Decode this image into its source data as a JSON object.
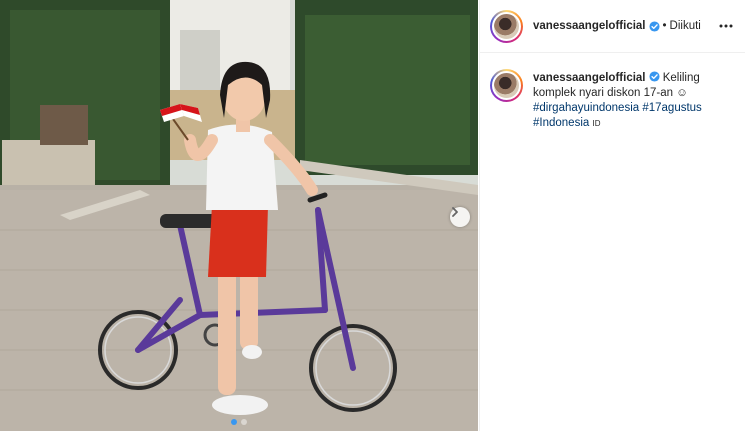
{
  "post": {
    "username": "vanessaangelofficial",
    "separator": "•",
    "follow_status": "Diikuti",
    "caption_text": "Keliling komplek nyari diskon 17-an ☺",
    "hashtags": [
      "#dirgahayuindonesia",
      "#17agustus",
      "#Indonesia"
    ],
    "flag_emoji": "ID"
  },
  "carousel": {
    "slide_count": 2,
    "active_index": 0
  },
  "colors": {
    "link": "#00376b",
    "verified": "#3897f0",
    "active_dot": "#3897f0"
  },
  "icons": {
    "verified": "verified-badge-icon",
    "more": "more-options-icon",
    "next": "chevron-right-icon"
  }
}
